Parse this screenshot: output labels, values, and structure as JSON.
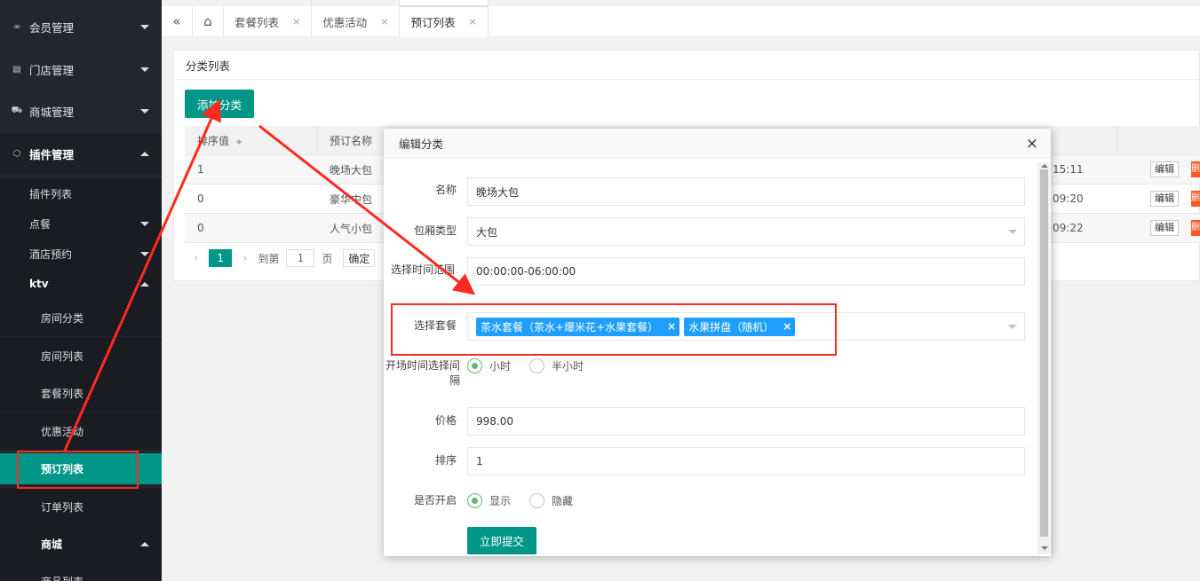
{
  "sidebar": {
    "top_items": [
      {
        "label": "会员管理",
        "icon": "link-icon"
      },
      {
        "label": "门店管理",
        "icon": "store-icon"
      },
      {
        "label": "商城管理",
        "icon": "cart-icon"
      },
      {
        "label": "插件管理",
        "icon": "cube-icon"
      }
    ],
    "sub_items": [
      {
        "label": "插件列表"
      },
      {
        "label": "点餐"
      },
      {
        "label": "酒店预约"
      },
      {
        "label": "ktv"
      }
    ],
    "ktv_items": [
      {
        "label": "房间分类"
      },
      {
        "label": "房间列表"
      },
      {
        "label": "套餐列表"
      },
      {
        "label": "优惠活动"
      },
      {
        "label": "预订列表"
      },
      {
        "label": "订单列表"
      },
      {
        "label": "商城"
      },
      {
        "label": "商品列表"
      }
    ]
  },
  "tabs": [
    {
      "label": "套餐列表",
      "close": "×"
    },
    {
      "label": "优惠活动",
      "close": "×"
    },
    {
      "label": "预订列表",
      "close": "×"
    }
  ],
  "tab_icons": {
    "collapse": "«",
    "home": "⌂"
  },
  "panel": {
    "title": "分类列表",
    "add_button": "添加分类",
    "table": {
      "headers": [
        "排序值",
        "预订名称"
      ],
      "rows": [
        {
          "sort": "1",
          "name": "晚场大包",
          "time": "15:11",
          "edit": "编辑",
          "del": "删"
        },
        {
          "sort": "0",
          "name": "豪华中包",
          "time": "09:20",
          "edit": "编辑",
          "del": "删"
        },
        {
          "sort": "0",
          "name": "人气小包",
          "time": "09:22",
          "edit": "编辑",
          "del": "删"
        }
      ]
    },
    "pager": {
      "prev": "‹",
      "current": "1",
      "next": "›",
      "goto": "到第",
      "page_input": "1",
      "page_unit": "页",
      "confirm": "确定"
    }
  },
  "modal": {
    "title": "编辑分类",
    "close": "×",
    "fields": {
      "name_label": "名称",
      "name_value": "晚场大包",
      "room_type_label": "包厢类型",
      "room_type_value": "大包",
      "time_range_label": "选择时间范围",
      "time_range_value": "00:00:00-06:00:00",
      "package_label": "选择套餐",
      "packages": [
        {
          "label": "茶水套餐（茶水+爆米花+水果套餐）",
          "remove": "×"
        },
        {
          "label": "水果拼盘（随机）",
          "remove": "×"
        }
      ],
      "interval_label": "开场时间选择间隔",
      "interval_options": [
        {
          "label": "小时",
          "checked": true
        },
        {
          "label": "半小时",
          "checked": false
        }
      ],
      "price_label": "价格",
      "price_value": "998.00",
      "sort_label": "排序",
      "sort_value": "1",
      "enabled_label": "是否开启",
      "enabled_options": [
        {
          "label": "显示",
          "checked": true
        },
        {
          "label": "隐藏",
          "checked": false
        }
      ]
    },
    "submit": "立即提交"
  },
  "colors": {
    "accent": "#009688",
    "sidebar_bg": "#23262e",
    "tag_blue": "#1e9fff",
    "annotation_red": "#ff2a1f"
  }
}
